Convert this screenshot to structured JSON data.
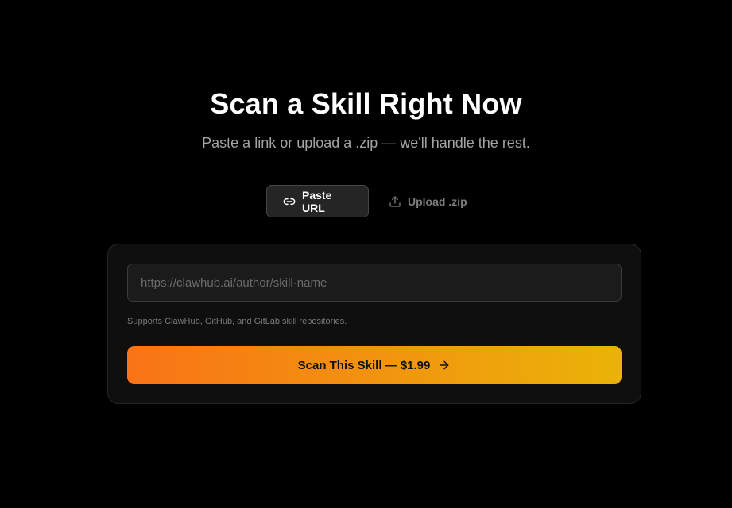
{
  "hero": {
    "title": "Scan a Skill Right Now",
    "subtitle": "Paste a link or upload a .zip — we'll handle the rest."
  },
  "tabs": [
    {
      "label": "Paste URL",
      "icon": "link-icon",
      "active": true
    },
    {
      "label": "Upload .zip",
      "icon": "upload-icon",
      "active": false
    }
  ],
  "form": {
    "url_value": "",
    "url_placeholder": "https://clawhub.ai/author/skill-name",
    "helper_text": "Supports ClawHub, GitHub, and GitLab skill repositories.",
    "submit_label": "Scan This Skill — $1.99",
    "submit_icon": "arrow-right-icon"
  },
  "colors": {
    "background": "#000000",
    "card": "#0f0f0f",
    "gradient_start": "#f97316",
    "gradient_end": "#eab308"
  }
}
